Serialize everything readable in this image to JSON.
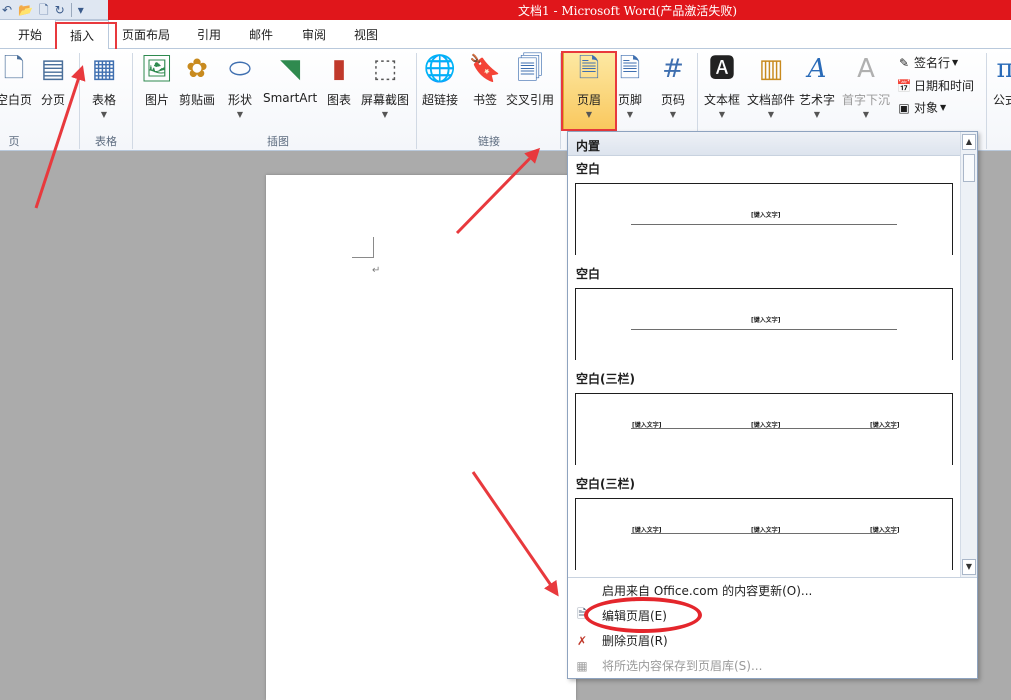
{
  "window": {
    "title": "文档1 - Microsoft Word(产品激活失败)"
  },
  "qat": {
    "items": [
      "undo-icon",
      "open-icon",
      "new-icon",
      "redo-icon",
      "customize-icon"
    ]
  },
  "tabs": [
    {
      "label": "开始"
    },
    {
      "label": "插入",
      "active": true
    },
    {
      "label": "页面布局"
    },
    {
      "label": "引用"
    },
    {
      "label": "邮件"
    },
    {
      "label": "审阅"
    },
    {
      "label": "视图"
    }
  ],
  "ribbon": {
    "groups": {
      "pages": "页",
      "tables": "表格",
      "illustrations": "插图",
      "links": "链接"
    },
    "buttons": {
      "blank_page": "空白页",
      "page_break": "分页",
      "table": "表格",
      "picture": "图片",
      "clip_art": "剪贴画",
      "shapes": "形状",
      "smartart": "SmartArt",
      "chart": "图表",
      "screenshot": "屏幕截图",
      "hyperlink": "超链接",
      "bookmark": "书签",
      "cross_reference": "交叉引用",
      "header": "页眉",
      "footer": "页脚",
      "page_number": "页码",
      "text_box": "文本框",
      "quick_parts": "文档部件",
      "wordart": "艺术字",
      "drop_cap": "首字下沉",
      "equation": "公式"
    },
    "small": {
      "signature_line": "签名行",
      "date_time": "日期和时间",
      "object": "对象"
    }
  },
  "dropdown": {
    "category": "内置",
    "items": [
      {
        "title": "空白",
        "placeholders": [
          "[键入文字]"
        ]
      },
      {
        "title": "空白",
        "placeholders": [
          "[键入文字]"
        ]
      },
      {
        "title": "空白(三栏)",
        "placeholders": [
          "[键入文字]",
          "[键入文字]",
          "[键入文字]"
        ]
      },
      {
        "title": "空白(三栏)",
        "placeholders": [
          "[键入文字]",
          "[键入文字]",
          "[键入文字]"
        ]
      }
    ],
    "menu": [
      {
        "label": "启用来自 Office.com 的内容更新(O)...",
        "icon": "",
        "disabled": false
      },
      {
        "label": "编辑页眉(E)",
        "icon": "edit-header-icon",
        "disabled": false
      },
      {
        "label": "删除页眉(R)",
        "icon": "remove-header-icon",
        "disabled": false
      },
      {
        "label": "将所选内容保存到页眉库(S)...",
        "icon": "save-selection-icon",
        "disabled": true
      }
    ]
  },
  "document": {
    "paragraph_mark": "↵"
  },
  "colors": {
    "annotation": "#e8393d",
    "titlebar": "#e0161b",
    "ribbon_border": "#b9c9dc"
  }
}
